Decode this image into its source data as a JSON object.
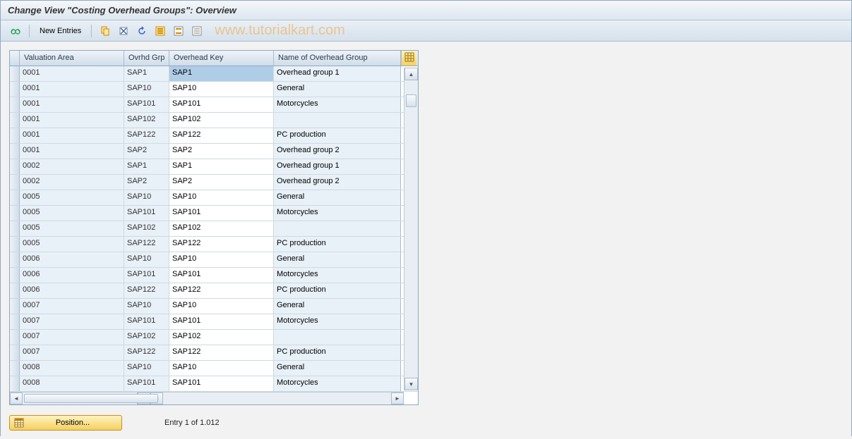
{
  "title": "Change View \"Costing Overhead Groups\": Overview",
  "toolbar": {
    "new_entries_label": "New Entries"
  },
  "watermark": "www.tutorialkart.com",
  "table": {
    "headers": {
      "valuation_area": "Valuation Area",
      "ovrhd_grp": "Ovrhd Grp",
      "overhead_key": "Overhead Key",
      "name": "Name of Overhead Group"
    },
    "rows": [
      {
        "va": "0001",
        "og": "SAP1",
        "ok": "SAP1",
        "name": "Overhead group 1",
        "selected": true
      },
      {
        "va": "0001",
        "og": "SAP10",
        "ok": "SAP10",
        "name": "General"
      },
      {
        "va": "0001",
        "og": "SAP101",
        "ok": "SAP101",
        "name": "Motorcycles"
      },
      {
        "va": "0001",
        "og": "SAP102",
        "ok": "SAP102",
        "name": ""
      },
      {
        "va": "0001",
        "og": "SAP122",
        "ok": "SAP122",
        "name": "PC production"
      },
      {
        "va": "0001",
        "og": "SAP2",
        "ok": "SAP2",
        "name": "Overhead group 2"
      },
      {
        "va": "0002",
        "og": "SAP1",
        "ok": "SAP1",
        "name": "Overhead group 1"
      },
      {
        "va": "0002",
        "og": "SAP2",
        "ok": "SAP2",
        "name": "Overhead group 2"
      },
      {
        "va": "0005",
        "og": "SAP10",
        "ok": "SAP10",
        "name": "General"
      },
      {
        "va": "0005",
        "og": "SAP101",
        "ok": "SAP101",
        "name": "Motorcycles"
      },
      {
        "va": "0005",
        "og": "SAP102",
        "ok": "SAP102",
        "name": ""
      },
      {
        "va": "0005",
        "og": "SAP122",
        "ok": "SAP122",
        "name": "PC production"
      },
      {
        "va": "0006",
        "og": "SAP10",
        "ok": "SAP10",
        "name": "General"
      },
      {
        "va": "0006",
        "og": "SAP101",
        "ok": "SAP101",
        "name": "Motorcycles"
      },
      {
        "va": "0006",
        "og": "SAP122",
        "ok": "SAP122",
        "name": "PC production"
      },
      {
        "va": "0007",
        "og": "SAP10",
        "ok": "SAP10",
        "name": "General"
      },
      {
        "va": "0007",
        "og": "SAP101",
        "ok": "SAP101",
        "name": "Motorcycles"
      },
      {
        "va": "0007",
        "og": "SAP102",
        "ok": "SAP102",
        "name": ""
      },
      {
        "va": "0007",
        "og": "SAP122",
        "ok": "SAP122",
        "name": "PC production"
      },
      {
        "va": "0008",
        "og": "SAP10",
        "ok": "SAP10",
        "name": "General"
      },
      {
        "va": "0008",
        "og": "SAP101",
        "ok": "SAP101",
        "name": "Motorcycles"
      }
    ]
  },
  "position_button": "Position...",
  "entry_status": "Entry 1 of 1.012"
}
